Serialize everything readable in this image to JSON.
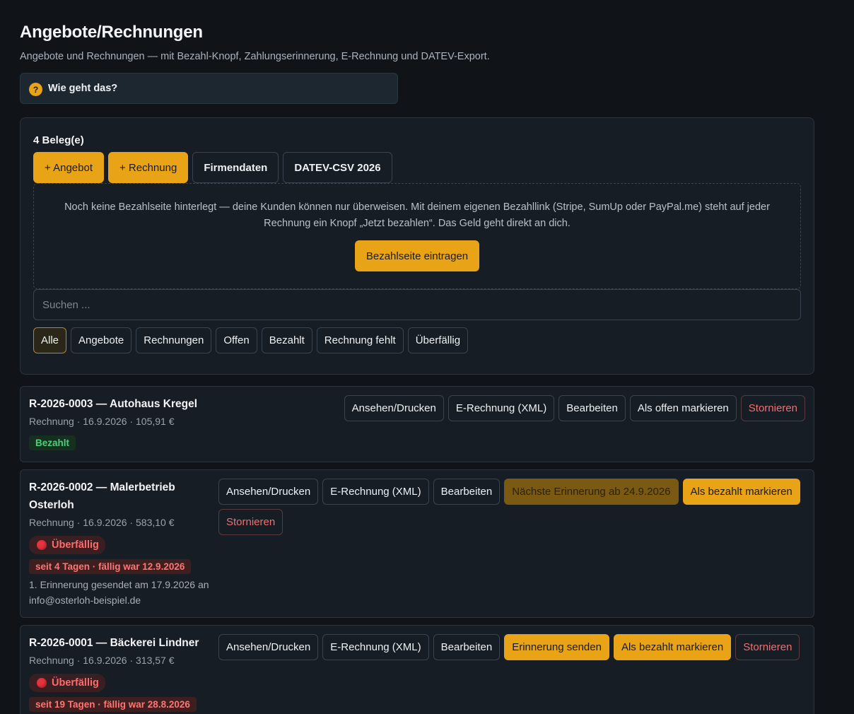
{
  "page": {
    "title": "Angebote/Rechnungen",
    "subtitle": "Angebote und Rechnungen — mit Bezahl-Knopf, Zahlungserinnerung, E-Rechnung und DATEV-Export.",
    "howto": "Wie geht das?",
    "howto_icon": "?"
  },
  "panel": {
    "count": "4 Beleg(e)",
    "toolbar": [
      "+ Angebot",
      "+ Rechnung",
      "Firmendaten",
      "DATEV-CSV 2026"
    ],
    "notice_text": "Noch keine Bezahlseite hinterlegt — deine Kunden können nur überweisen. Mit deinem eigenen Bezahllink (Stripe, SumUp oder PayPal.me) steht auf jeder Rechnung ein Knopf „Jetzt bezahlen“. Das Geld geht direkt an dich.",
    "notice_button": "Bezahlseite eintragen",
    "search_placeholder": "Suchen ...",
    "filters": [
      "Alle",
      "Angebote",
      "Rechnungen",
      "Offen",
      "Bezahlt",
      "Rechnung fehlt",
      "Überfällig"
    ],
    "active_filter": "Alle"
  },
  "invoices": [
    {
      "title": "R-2026-0003 — Autohaus Kregel",
      "meta": "Rechnung · 16.9.2026 · 105,91 €",
      "status": "Bezahlt",
      "actions": [
        "Ansehen/Drucken",
        "E-Rechnung (XML)",
        "Bearbeiten",
        "Als offen markieren",
        "Stornieren"
      ]
    },
    {
      "title": "R-2026-0002 — Malerbetrieb Osterloh",
      "meta": "Rechnung · 16.9.2026 · 583,10 €",
      "status": "Überfällig",
      "since": "seit 4 Tagen · fällig war 12.9.2026",
      "sent": "1. Erinnerung gesendet am 17.9.2026 an info@osterloh-beispiel.de",
      "actions": [
        "Ansehen/Drucken",
        "E-Rechnung (XML)",
        "Bearbeiten",
        "Nächste Erinnerung ab 24.9.2026",
        "Als bezahlt markieren",
        "Stornieren"
      ]
    },
    {
      "title": "R-2026-0001 — Bäckerei Lindner",
      "meta": "Rechnung · 16.9.2026 · 313,57 €",
      "status": "Überfällig",
      "since": "seit 19 Tagen · fällig war 28.8.2026",
      "actions": [
        "Ansehen/Drucken",
        "E-Rechnung (XML)",
        "Bearbeiten",
        "Erinnerung senden",
        "Als bezahlt markieren",
        "Stornieren"
      ]
    }
  ],
  "colors": {
    "accent": "#e8a317",
    "background": "#101418",
    "panel": "#171d24",
    "paid": "#4cd07a",
    "overdue": "#ff6b6b"
  }
}
